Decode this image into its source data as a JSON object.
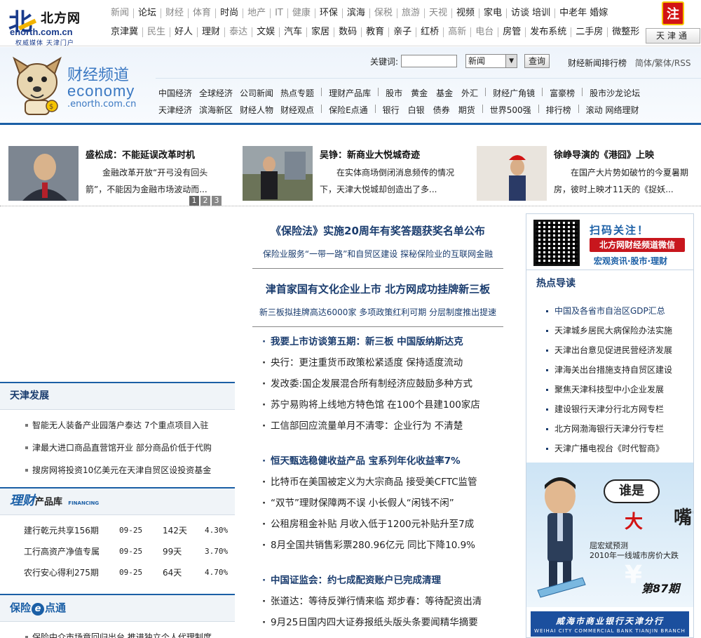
{
  "logo": {
    "name": "北方网",
    "domain": "enorth.com.cn",
    "slogan": "权威媒体 天津门户",
    "badge": "注"
  },
  "nav_top": [
    {
      "label": "新闻",
      "gray": true
    },
    {
      "label": "论坛"
    },
    {
      "label": "财经",
      "gray": true
    },
    {
      "label": "体育",
      "gray": true
    },
    {
      "label": "时尚"
    },
    {
      "label": "地产",
      "gray": true
    },
    {
      "label": "IT",
      "gray": true
    },
    {
      "label": "健康",
      "gray": true
    },
    {
      "label": "环保"
    },
    {
      "label": "滨海"
    },
    {
      "label": "保税",
      "gray": true
    },
    {
      "label": "旅游",
      "gray": true
    },
    {
      "label": "天视",
      "gray": true
    },
    {
      "label": "视频"
    },
    {
      "label": "家电"
    },
    {
      "label": "访谈 培训"
    },
    {
      "label": "中老年 婚嫁"
    }
  ],
  "nav_bottom": [
    {
      "label": "京津冀"
    },
    {
      "label": "民生",
      "gray": true
    },
    {
      "label": "好人"
    },
    {
      "label": "理财"
    },
    {
      "label": "泰达",
      "gray": true
    },
    {
      "label": "文娱"
    },
    {
      "label": "汽车"
    },
    {
      "label": "家居"
    },
    {
      "label": "数码"
    },
    {
      "label": "教育"
    },
    {
      "label": "亲子"
    },
    {
      "label": "红桥"
    },
    {
      "label": "高新",
      "gray": true
    },
    {
      "label": "电台",
      "gray": true
    },
    {
      "label": "房管"
    },
    {
      "label": "发布系统"
    },
    {
      "label": "二手房"
    },
    {
      "label": "微整形"
    }
  ],
  "city_button": "天津通",
  "channel": {
    "title": "财经频道",
    "english": "economy",
    "domain": ".enorth.com.cn"
  },
  "search": {
    "keyword_label": "关键词:",
    "value": "",
    "category": "新闻",
    "submit": "查询"
  },
  "rank_link": "财经新闻排行榜",
  "lang_links": "简体/繁体/RSS",
  "channel_nav": {
    "row1": [
      [
        "中国经济",
        "全球经济",
        "公司新闻",
        "热点专题"
      ],
      [
        "理财产品库"
      ],
      [
        "股市",
        "黄金",
        "基金",
        "外汇"
      ],
      [
        "财经广角镜"
      ],
      [
        "富豪榜"
      ],
      [
        "股市沙龙论坛"
      ]
    ],
    "row2": [
      [
        "天津经济",
        "滨海新区",
        "财经人物",
        "财经观点"
      ],
      [
        "保险E点通"
      ],
      [
        "银行",
        "白银",
        "债券",
        "期货"
      ],
      [
        "世界500强"
      ],
      [
        "排行榜"
      ],
      [
        "滚动 网络理财"
      ]
    ]
  },
  "featured": [
    {
      "title": "盛松成：不能延误改革时机",
      "desc": "金融改革开放“开弓没有回头箭”，不能因为金融市场波动而..."
    },
    {
      "title": "吴铮：新商业大悦城奇迹",
      "desc": "在实体商场倒闭消息频传的情况下，天津大悦城却创造出了多..."
    },
    {
      "title": "徐峥导演的《港囧》上映",
      "desc": "在国产大片势如破竹的今夏暑期房，彼时上映才11天的《捉妖..."
    }
  ],
  "pager": [
    "1",
    "2",
    "3"
  ],
  "headlines": [
    {
      "title": "《保险法》实施20周年有奖答题获奖名单公布",
      "sub": "保险业服务“一带一路”和自贸区建设 探秘保险业的互联网金融"
    },
    {
      "title": "津首家国有文化企业上市 北方网成功挂牌新三板",
      "sub": "新三板拟挂牌高达6000家 多项政策红利可期 分层制度推出提速"
    }
  ],
  "news_groups": [
    [
      "我要上市访谈第五期：新三板 中国版纳斯达克",
      "央行：更注重货币政策松紧适度 保持适度流动",
      "发改委:国企发展混合所有制经济应鼓励多种方式",
      "苏宁易购将上线地方特色馆 在100个县建100家店",
      "工信部回应流量单月不清零：企业行为 不清楚"
    ],
    [
      "恒天甄选稳健收益产品 宝系列年化收益率7%",
      "比特币在美国被定义为大宗商品 接受美CFTC监管",
      "“双节”理财保障两不误 小长假人“闲钱不闲”",
      "公租房租金补贴 月收入低于1200元补贴升至7成",
      "8月全国共销售彩票280.96亿元 同比下降10.9%"
    ],
    [
      "中国证监会：约七成配资账户已完成清理",
      "张道达：等待反弹行情来临 郑步春：等待配资出清",
      "9月25日国内四大证券报纸头版头条要闻精华摘要"
    ]
  ],
  "tianjin": {
    "title": "天津发展",
    "items": [
      "智能无人装备产业园落户泰达 7个重点项目入驻",
      "津最大进口商品直营馆开业 部分商品价低于代购",
      "搜房网将投资10亿美元在天津自贸区设投资基金"
    ]
  },
  "licai": {
    "title": "理财",
    "subtitle": "产品库",
    "tag": "FINANCING",
    "rows": [
      {
        "name": "建行乾元共享156期",
        "date": "09-25",
        "period": "142天",
        "rate": "4.30%"
      },
      {
        "name": "工行高资产净值专属",
        "date": "09-25",
        "period": "99天",
        "rate": "3.70%"
      },
      {
        "name": "农行安心得利275期",
        "date": "09-25",
        "period": "64天",
        "rate": "4.70%"
      }
    ]
  },
  "baoxian": {
    "title": "保险",
    "e": "e",
    "suffix": "点通",
    "items": [
      "保险中介市场竟回归出台 推进独立个人代理制度"
    ]
  },
  "qr": {
    "line1": "扫码关注！",
    "line2": "北方网财经频道微信",
    "line3": "宏观资讯·股市·理财"
  },
  "hot": {
    "title": "热点导读",
    "items": [
      "中国及各省市自治区GDP汇总",
      "天津城乡居民大病保险办法实施",
      "天津出台意见促进民营经济发展",
      "津海关出台措施支持自贸区建设",
      "聚焦天津科技型中小企业发展",
      "建设银行天津分行北方网专栏",
      "北方网渤海银行天津分行专栏",
      "天津广播电视台《时代智商》"
    ]
  },
  "ad": {
    "q1": "谁是",
    "q2": "大",
    "q3": "嘴?",
    "pred1": "屈宏斌预测",
    "pred2": "2010年一线城市房价大跌",
    "issue": "第87期",
    "yen": "¥"
  },
  "bank_ad": {
    "name": "威海市商业银行天津分行",
    "english": "WEIHAI CITY COMMERCIAL BANK TIANJIN BRANCH"
  }
}
